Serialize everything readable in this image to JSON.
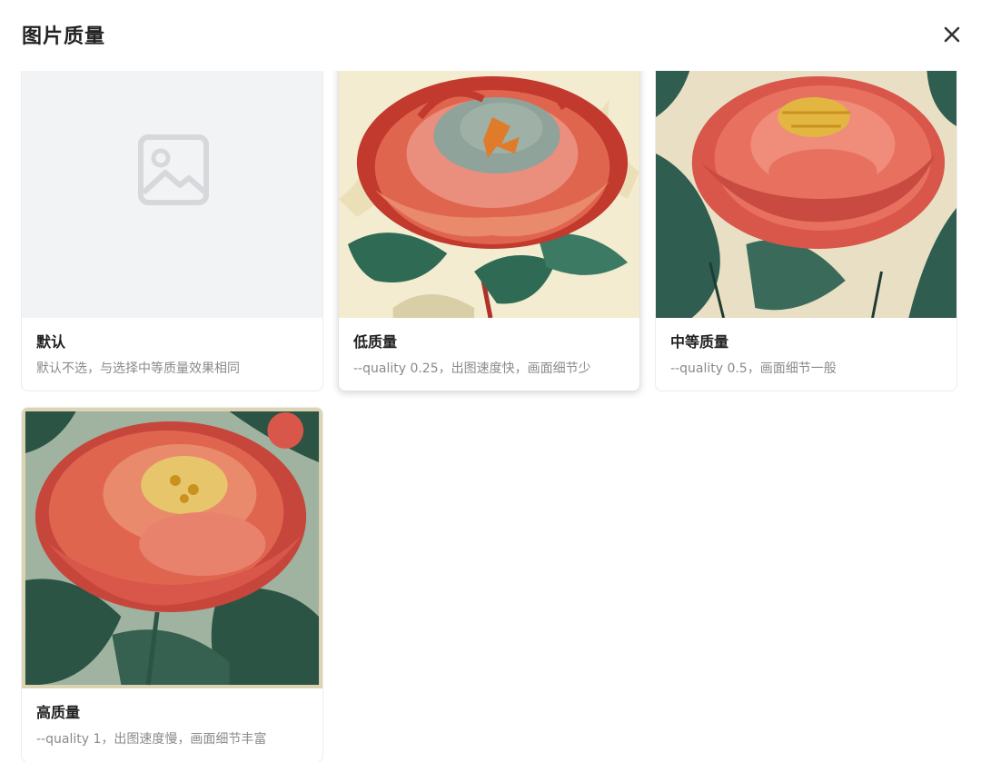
{
  "dialog": {
    "title": "图片质量",
    "close_icon": "close-icon"
  },
  "options": [
    {
      "name": "默认",
      "desc": "默认不选，与选择中等质量效果相同",
      "image": "image-placeholder-icon",
      "selected": false
    },
    {
      "name": "低质量",
      "desc": "--quality 0.25，出图速度快，画面细节少",
      "image": "peony-illustration-cream",
      "selected": true
    },
    {
      "name": "中等质量",
      "desc": "--quality 0.5，画面细节一般",
      "image": "peony-illustration-green",
      "selected": false
    },
    {
      "name": "高质量",
      "desc": "--quality 1，出图速度慢，画面细节丰富",
      "image": "peony-illustration-detailed",
      "selected": false
    }
  ],
  "colors": {
    "placeholder_bg": "#f2f3f4",
    "placeholder_icon": "#d6d8db",
    "peony_red": "#e0654f",
    "leaf_green": "#2f5d4f",
    "cream": "#f3ecd0"
  }
}
